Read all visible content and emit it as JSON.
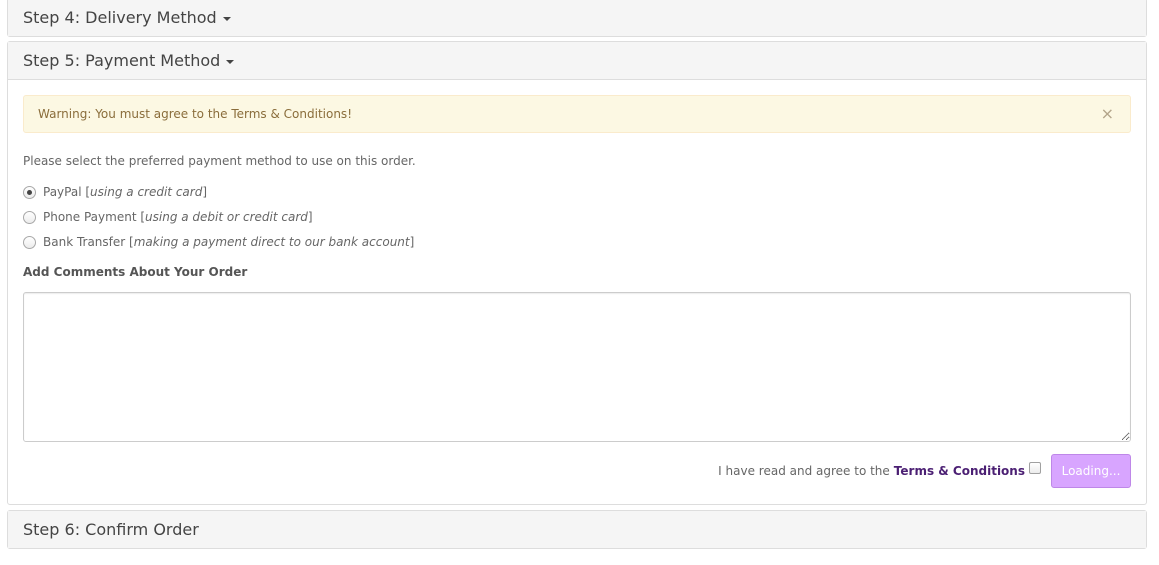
{
  "step4": {
    "title": "Step 4: Delivery Method"
  },
  "step5": {
    "title": "Step 5: Payment Method",
    "alert": {
      "text": "Warning: You must agree to the Terms & Conditions!",
      "close": "×"
    },
    "intro": "Please select the preferred payment method to use on this order.",
    "methods": [
      {
        "name": "PayPal",
        "detail": "using a credit card",
        "checked": true
      },
      {
        "name": "Phone Payment",
        "detail": "using a debit or credit card",
        "checked": false
      },
      {
        "name": "Bank Transfer",
        "detail": "making a payment direct to our bank account",
        "checked": false
      }
    ],
    "comments_label": "Add Comments About Your Order",
    "comments_value": "",
    "agree_text": "I have read and agree to the",
    "terms_link": "Terms & Conditions",
    "agree_checked": false,
    "button_label": "Loading..."
  },
  "step6": {
    "title": "Step 6: Confirm Order"
  },
  "colors": {
    "alert_bg": "#fcf8e3",
    "alert_text": "#8a6d3b",
    "link": "#4b1f73",
    "button_bg": "#d49cff"
  }
}
